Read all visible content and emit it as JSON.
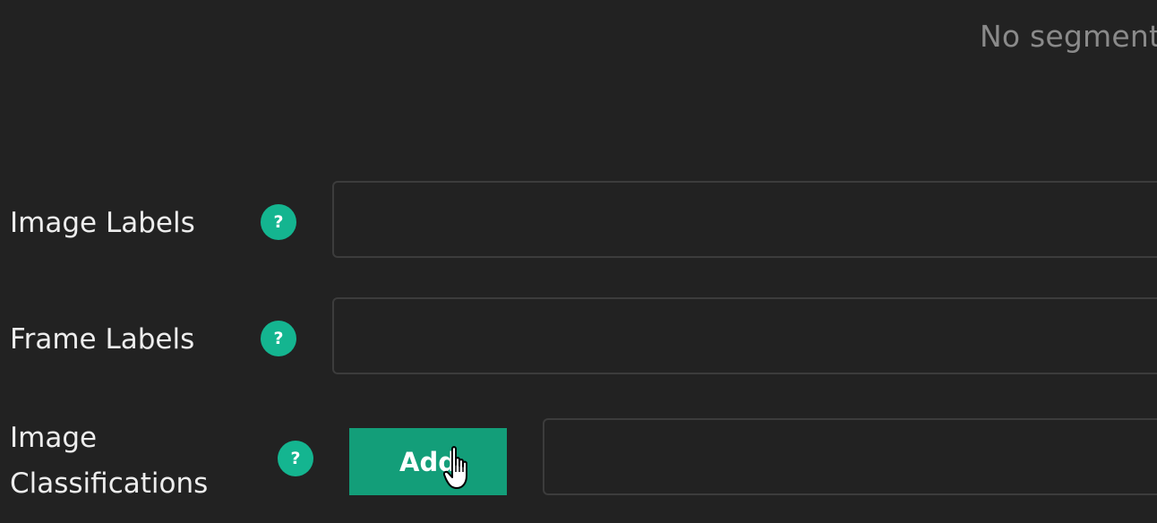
{
  "header": {
    "no_segmentation_text": "No segmenta"
  },
  "rows": {
    "image_labels": {
      "label": "Image Labels",
      "help": "?"
    },
    "frame_labels": {
      "label": "Frame Labels",
      "help": "?"
    },
    "image_classifications": {
      "label_line1": "Image",
      "label_line2": "Classifications",
      "help": "?",
      "add_button_label": "Add"
    }
  },
  "colors": {
    "background": "#222222",
    "accent": "#14b590",
    "button": "#139e79",
    "text": "#ededed",
    "muted_text": "#8a8a8a",
    "border": "#3c3c3c"
  },
  "icons": {
    "cursor": "hand-pointer-icon"
  }
}
